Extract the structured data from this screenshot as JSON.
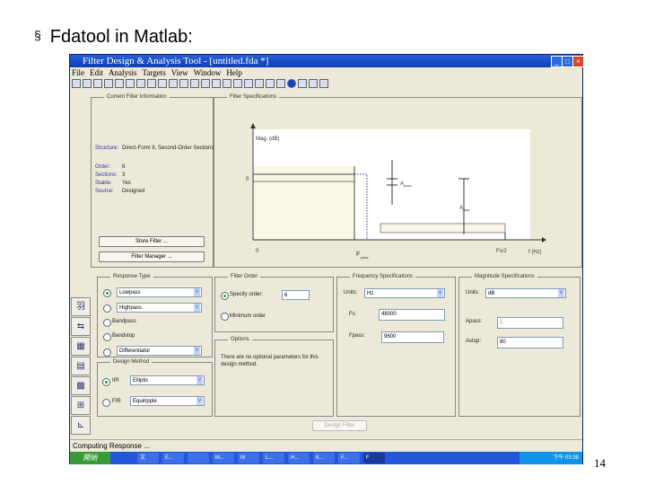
{
  "slide": {
    "bullet": "§",
    "title": "Fdatool in Matlab:",
    "page_number": "14"
  },
  "window": {
    "title": "Filter Design & Analysis Tool -  [untitled.fda *]",
    "menu": [
      "File",
      "Edit",
      "Analysis",
      "Targets",
      "View",
      "Window",
      "Help"
    ]
  },
  "current_filter": {
    "legend": "Current Filter Information",
    "structure_label": "Structure:",
    "structure": "Direct-Form II, Second-Order Sections",
    "order_label": "Order:",
    "order": "6",
    "sections_label": "Sections:",
    "sections": "3",
    "stable_label": "Stable:",
    "stable": "Yes",
    "source_label": "Source:",
    "source": "Designed",
    "store_button": "Store Filter ...",
    "manager_button": "Filter Manager ..."
  },
  "filter_specs": {
    "legend": "Filter Specifications",
    "ylabel": "Mag. (dB)",
    "zero_y": "0",
    "zero_x": "0",
    "fpass": "F",
    "fpass_sub": "pass",
    "apass": "A",
    "apass_sub": "pass",
    "astop": "A",
    "astop_sub": "stop",
    "fs2": "Fs/2",
    "xlabel": "f (Hz)"
  },
  "response_type": {
    "legend": "Response Type",
    "lowpass": "Lowpass",
    "highpass": "Highpass",
    "bandpass": "Bandpass",
    "bandstop": "Bandstop",
    "differentiator": "Differentiator"
  },
  "design_method": {
    "legend": "Design Method",
    "iir": "IIR",
    "iir_value": "Elliptic",
    "fir": "FIR",
    "fir_value": "Equiripple"
  },
  "filter_order": {
    "legend": "Filter Order",
    "specify": "Specify order:",
    "order_value": "6",
    "minimum": "Minimum order"
  },
  "options": {
    "legend": "Options",
    "text": "There are no optional parameters for this design method."
  },
  "freq_specs": {
    "legend": "Frequency Specifications",
    "units_label": "Units:",
    "units": "Hz",
    "fs_label": "Fs:",
    "fs": "48000",
    "fpass_label": "Fpass:",
    "fpass": "9600"
  },
  "mag_specs": {
    "legend": "Magnitude Specifications",
    "units_label": "Units:",
    "units": "dB",
    "apass_label": "Apass:",
    "apass": "1",
    "astop_label": "Astop:",
    "astop": "80"
  },
  "design_button": "Design Filter",
  "status": "Computing Response ...",
  "taskbar": {
    "start": "開始",
    "tasks": [
      "文",
      "E...",
      "",
      "M...",
      "M",
      "L...",
      "H...",
      "6...",
      "F...",
      "F"
    ],
    "clock": "下午 03:38"
  }
}
